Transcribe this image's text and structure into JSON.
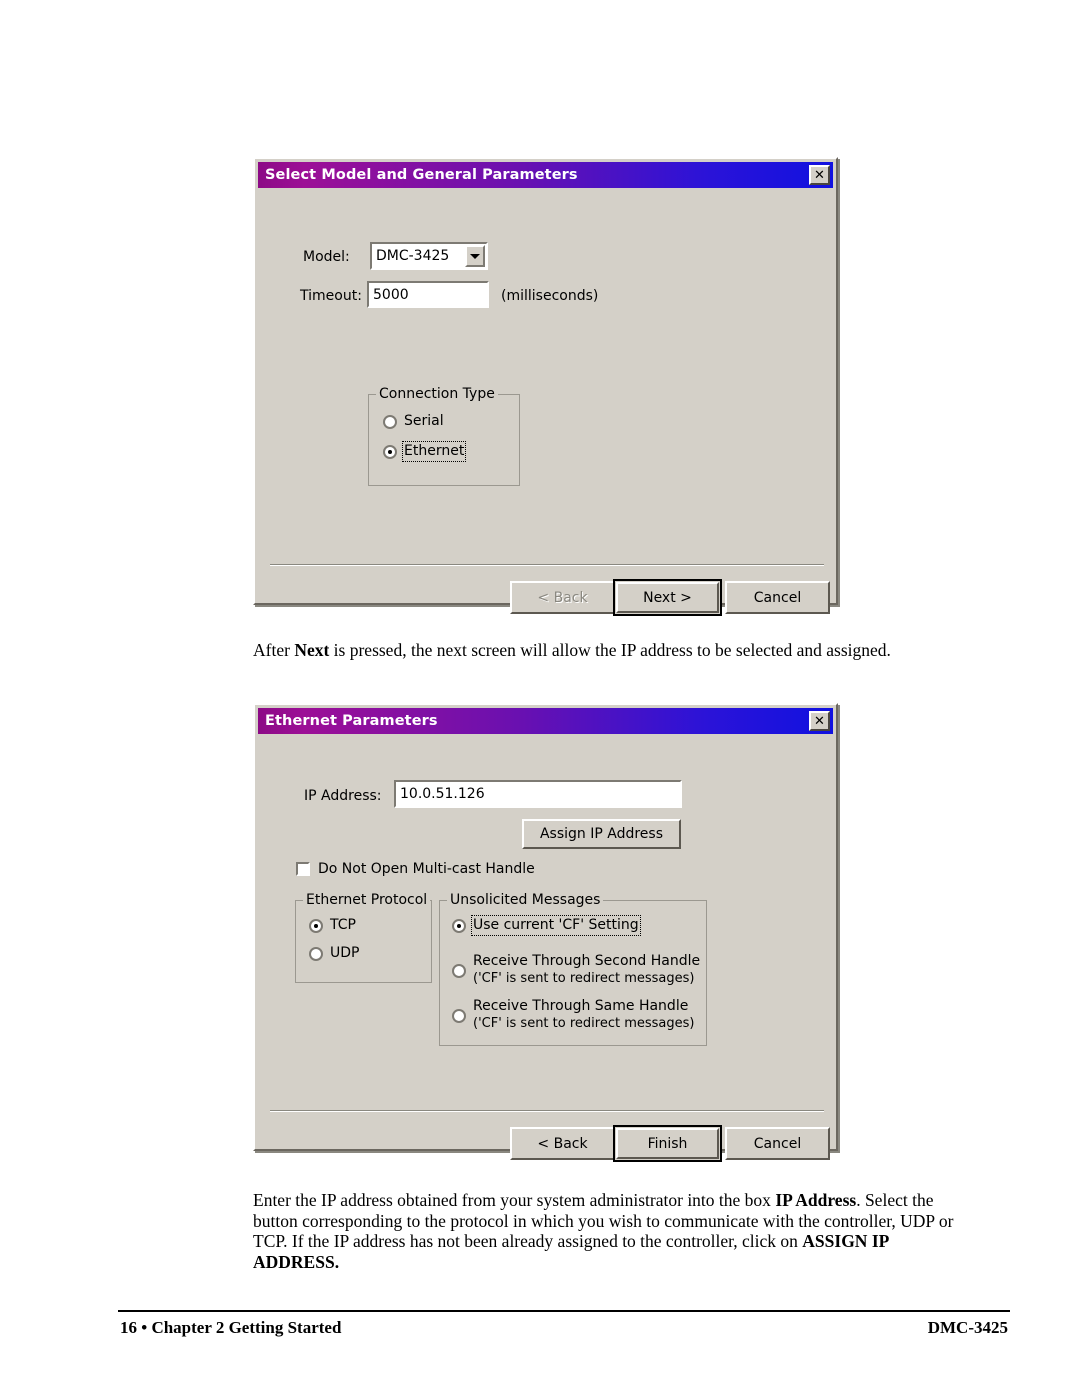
{
  "page": {
    "body_text_1": "After Next is pressed, the next screen will allow the IP address to be selected and assigned.",
    "body_text_2_line1": "Enter the IP address obtained from your system administrator into the box IP Address.  Select the",
    "body_text_2_line2": "button corresponding to the protocol in which you wish to communicate with the controller, UDP or",
    "body_text_2_line3": "TCP.  If the IP address has not been already assigned to the controller, click on ASSIGN IP",
    "body_text_2_line4": "ADDRESS.",
    "footer_left": "16 • Chapter 2  Getting Started",
    "footer_right": "DMC-3425"
  },
  "theme": {
    "title_gradient_start": "#8c0a86",
    "title_gradient_end": "#1111e0",
    "dialog_face": "#d4d0c8",
    "title_text": "#ffffff"
  },
  "dialog1": {
    "title": "Select Model and General Parameters",
    "close_glyph": "✕",
    "model_label": "Model:",
    "model_value": "DMC-3425",
    "model_options": [
      "DMC-3425"
    ],
    "timeout_label": "Timeout:",
    "timeout_value": "5000",
    "timeout_units": "(milliseconds)",
    "connection_group_title": "Connection Type",
    "radios": [
      {
        "label": "Serial",
        "selected": false,
        "focused": false
      },
      {
        "label": "Ethernet",
        "selected": true,
        "focused": true
      }
    ],
    "buttons": {
      "back": "< Back",
      "next": "Next >",
      "cancel": "Cancel"
    }
  },
  "dialog2": {
    "title": "Ethernet Parameters",
    "close_glyph": "✕",
    "ip_label": "IP Address:",
    "ip_value": "10.0.51.126",
    "assign_button": "Assign IP Address",
    "multicast_checkbox_label": "Do Not Open Multi-cast Handle",
    "multicast_checked": false,
    "protocol_group_title": "Ethernet Protocol",
    "protocol_radios": [
      {
        "label": "TCP",
        "selected": true
      },
      {
        "label": "UDP",
        "selected": false
      }
    ],
    "unsolicited_group_title": "Unsolicited Messages",
    "unsolicited_radios": [
      {
        "label": "Use current 'CF' Setting",
        "sub": "",
        "selected": true,
        "focused": true
      },
      {
        "label": "Receive Through Second Handle",
        "sub": "('CF' is sent to redirect messages)",
        "selected": false,
        "focused": false
      },
      {
        "label": "Receive Through Same Handle",
        "sub": "('CF' is sent to redirect messages)",
        "selected": false,
        "focused": false
      }
    ],
    "buttons": {
      "back": "< Back",
      "finish": "Finish",
      "cancel": "Cancel"
    }
  }
}
